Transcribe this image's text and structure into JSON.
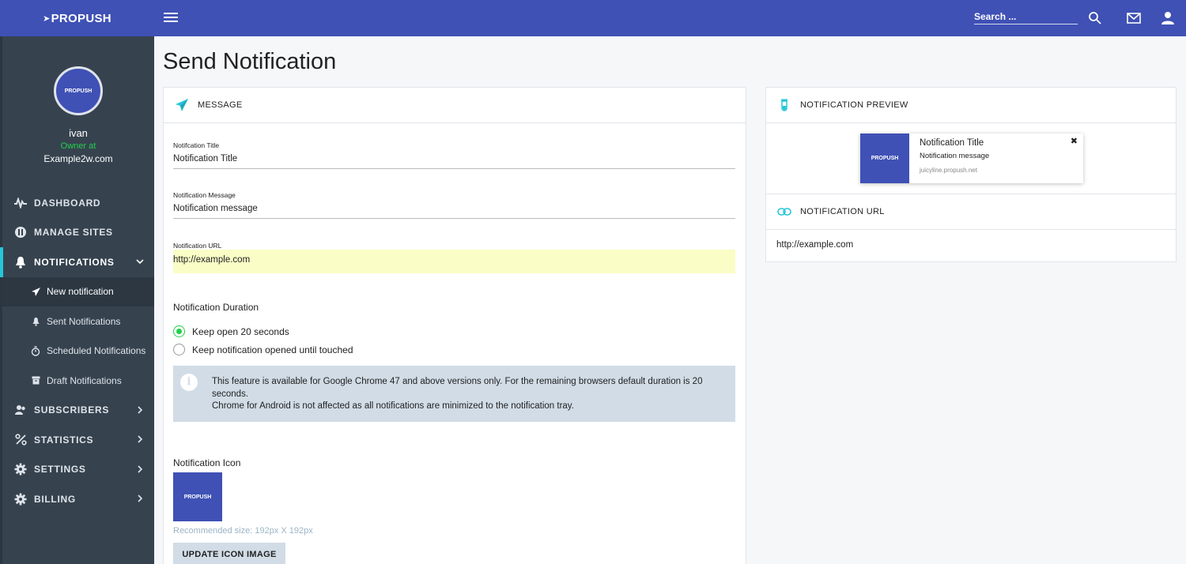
{
  "header": {
    "logo": "PROPUSH",
    "search_placeholder": "Search ...",
    "icons": [
      "menu-icon",
      "search-icon",
      "mail-icon",
      "user-icon"
    ]
  },
  "profile": {
    "avatar_text": "PROPUSH",
    "name": "ivan",
    "role": "Owner at",
    "site": "Example2w.com"
  },
  "sidebar": {
    "items": [
      {
        "label": "DASHBOARD",
        "icon": "pulse-icon"
      },
      {
        "label": "MANAGE SITES",
        "icon": "sites-icon"
      },
      {
        "label": "NOTIFICATIONS",
        "icon": "bell-icon"
      },
      {
        "label": "SUBSCRIBERS",
        "icon": "users-icon"
      },
      {
        "label": "STATISTICS",
        "icon": "percent-icon"
      },
      {
        "label": "SETTINGS",
        "icon": "gear-icon"
      },
      {
        "label": "BILLING",
        "icon": "gear-icon"
      }
    ],
    "subitems": [
      {
        "label": "New notification",
        "icon": "send-icon"
      },
      {
        "label": "Sent Notifications",
        "icon": "bell-icon"
      },
      {
        "label": "Scheduled Notifications",
        "icon": "timer-icon"
      },
      {
        "label": "Draft Notifications",
        "icon": "archive-icon"
      }
    ]
  },
  "page": {
    "title": "Send Notification"
  },
  "message_card": {
    "header": "MESSAGE",
    "title_label": "Notifcation Title",
    "title_value": "Notification Title",
    "message_label": "Notification Message",
    "message_value": "Notification message",
    "url_label": "Notification URL",
    "url_value": "http://example.com",
    "duration_label": "Notification Duration",
    "option1": "Keep open 20 seconds",
    "option2": "Keep notification opened until touched",
    "info_line1": "This feature is available for Google Chrome 47 and above versions only. For the remaining browsers default duration is 20 seconds.",
    "info_line2": "Chrome for Android is not affected as all notifications are minimized to the notification tray.",
    "icon_label": "Notification Icon",
    "icon_text": "PROPUSH",
    "hint": "Recommended size: 192px X 192px",
    "update_button": "UPDATE ICON IMAGE"
  },
  "preview_card": {
    "header": "NOTIFICATION PREVIEW",
    "logo_text": "PROPUSH",
    "title": "Notification Title",
    "message": "Notification message",
    "domain": "juicyline.propush.net",
    "close": "✖"
  },
  "url_card": {
    "header": "NOTIFICATION URL",
    "value": "http://example.com"
  },
  "colors": {
    "brand": "#3f51b5",
    "sidebar": "#36434f",
    "accent": "#26c6da",
    "success": "#22d04b",
    "highlight": "#fafdc6"
  }
}
